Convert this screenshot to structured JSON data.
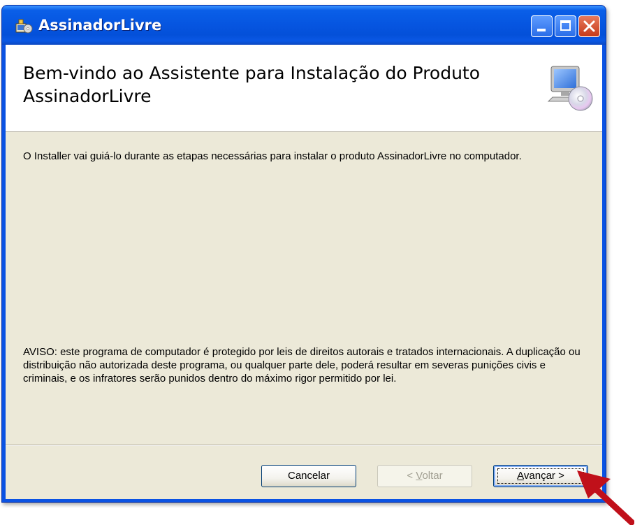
{
  "window": {
    "title": "AssinadorLivre"
  },
  "header": {
    "title": "Bem-vindo ao Assistente para Instalação do Produto AssinadorLivre",
    "icon": "computer-cd-icon"
  },
  "body": {
    "intro": "O Installer vai guiá-lo durante as etapas necessárias para instalar o produto AssinadorLivre no computador.",
    "warning": "AVISO: este programa de computador é protegido por leis de direitos autorais e tratados internacionais. A duplicação ou distribuição não autorizada deste programa, ou qualquer parte dele, poderá resultar em severas punições civis e criminais, e os infratores serão punidos dentro do máximo rigor permitido por lei."
  },
  "buttons": {
    "cancel": "Cancelar",
    "back_prefix": "< ",
    "back_accel": "V",
    "back_rest": "oltar",
    "next_accel": "A",
    "next_rest": "vançar >"
  },
  "colors": {
    "titlebar": "#0a5fe8",
    "client": "#ece9d8",
    "arrow": "#c0101a"
  }
}
